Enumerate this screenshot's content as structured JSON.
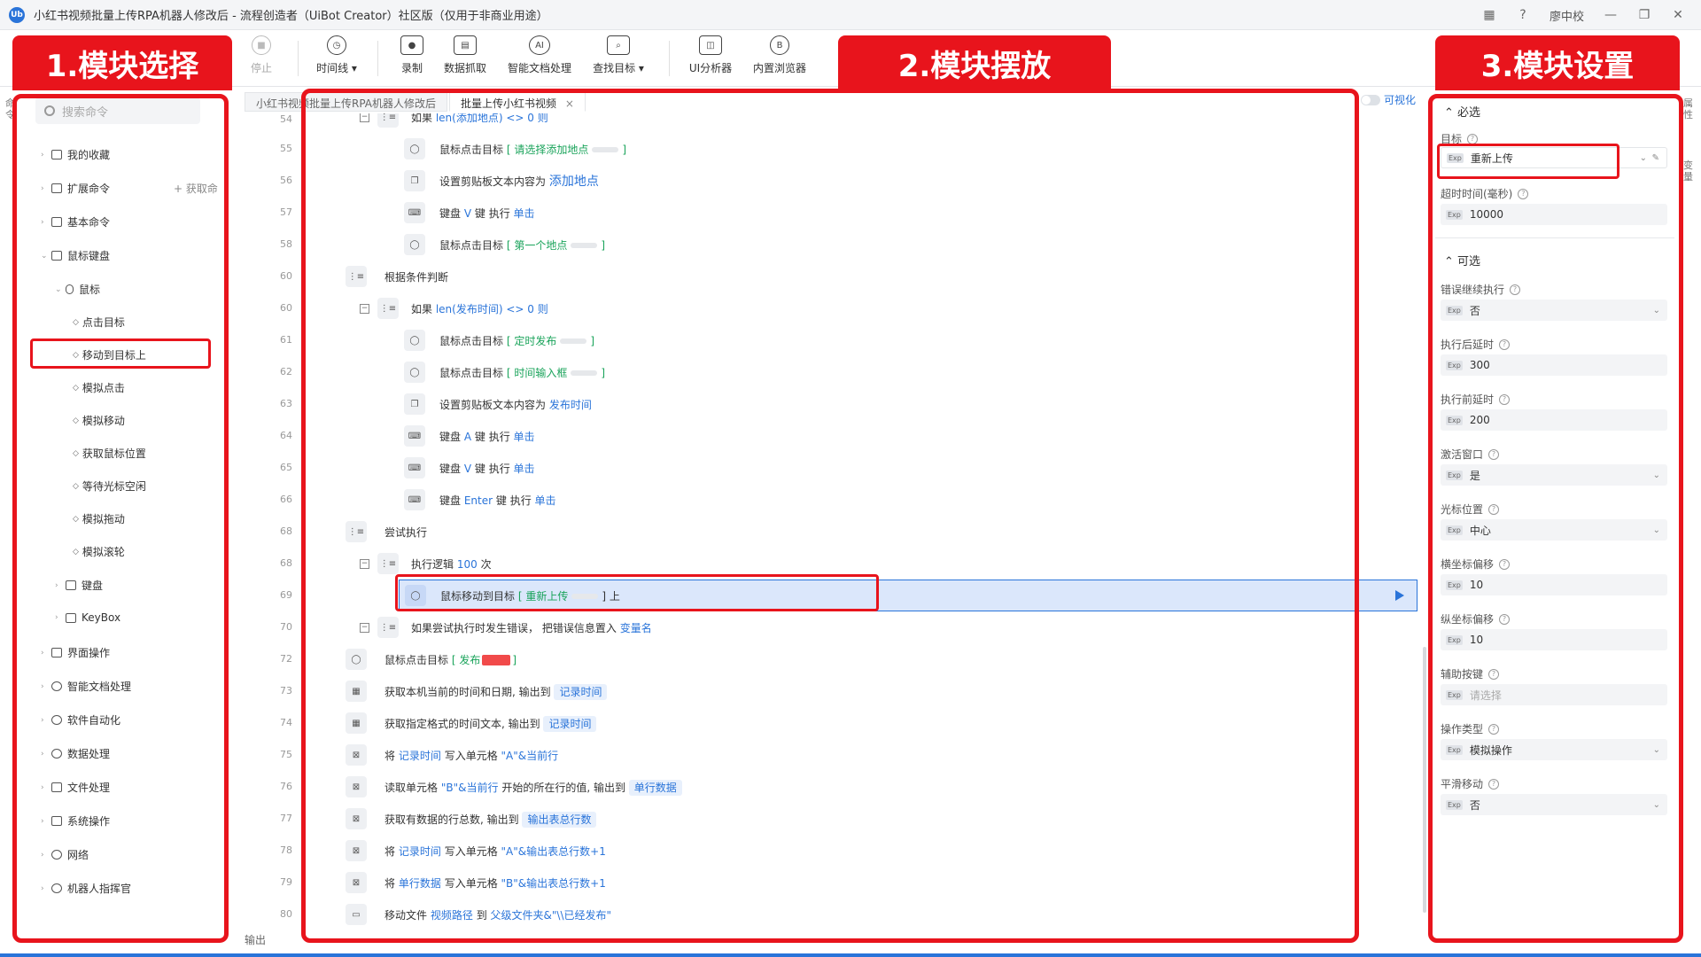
{
  "titlebar": {
    "logo": "Ub",
    "title": "小红书视频批量上传RPA机器人修改后 - 流程创造者（UiBot Creator）社区版（仅用于非商业用途）",
    "user": "廖中校",
    "help": "?"
  },
  "toolbar": {
    "stop": "停止",
    "timeline": "时间线 ▾",
    "record": "录制",
    "data_scrape": "数据抓取",
    "smart_doc": "智能文档处理",
    "find_target": "查找目标 ▾",
    "ui_analyzer": "UI分析器",
    "builtin_browser": "内置浏览器"
  },
  "annotations": {
    "label1": "1.模块选择",
    "label2": "2.模块摆放",
    "label3": "3.模块设置"
  },
  "left": {
    "search_placeholder": "搜索命令",
    "extra_action": "+ 获取命",
    "items": [
      {
        "label": "我的收藏",
        "arrow": "›"
      },
      {
        "label": "扩展命令",
        "arrow": "›"
      },
      {
        "label": "基本命令",
        "arrow": "›"
      },
      {
        "label": "鼠标键盘",
        "arrow": "⌄"
      },
      {
        "label": "鼠标",
        "arrow": "⌄"
      },
      {
        "label": "点击目标"
      },
      {
        "label": "移动到目标上"
      },
      {
        "label": "模拟点击"
      },
      {
        "label": "模拟移动"
      },
      {
        "label": "获取鼠标位置"
      },
      {
        "label": "等待光标空闲"
      },
      {
        "label": "模拟拖动"
      },
      {
        "label": "模拟滚轮"
      },
      {
        "label": "键盘",
        "arrow": "›"
      },
      {
        "label": "KeyBox",
        "arrow": "›"
      },
      {
        "label": "界面操作",
        "arrow": "›"
      },
      {
        "label": "智能文档处理",
        "arrow": "›"
      },
      {
        "label": "软件自动化",
        "arrow": "›"
      },
      {
        "label": "数据处理",
        "arrow": "›"
      },
      {
        "label": "文件处理",
        "arrow": "›"
      },
      {
        "label": "系统操作",
        "arrow": "›"
      },
      {
        "label": "网络",
        "arrow": "›"
      },
      {
        "label": "机器人指挥官",
        "arrow": "›"
      }
    ]
  },
  "center": {
    "tab1": "小红书视频批量上传RPA机器人修改后",
    "tab2": "批量上传小红书视频",
    "tab_close": "×",
    "visual_toggle": "可视化",
    "output": "输出",
    "lines": [
      "54",
      "55",
      "56",
      "57",
      "58",
      "60",
      "60",
      "61",
      "62",
      "63",
      "64",
      "65",
      "66",
      "68",
      "68",
      "69",
      "70",
      "72",
      "73",
      "74",
      "75",
      "76",
      "77",
      "78",
      "79",
      "80"
    ],
    "rows": {
      "r54": {
        "a": "如果",
        "b": "len(添加地点)",
        "c": "<> 0 则"
      },
      "r55": {
        "a": "鼠标点击目标",
        "b": "[ 请选择添加地点",
        "c": "]"
      },
      "r56": {
        "a": "设置剪贴板文本内容为",
        "b": "添加地点"
      },
      "r57": {
        "a": "键盘",
        "b": "V",
        "c": "键 执行",
        "d": "单击"
      },
      "r58": {
        "a": "鼠标点击目标",
        "b": "[ 第一个地点",
        "c": "]"
      },
      "r60a": {
        "a": "根据条件判断"
      },
      "r60b": {
        "a": "如果",
        "b": "len(发布时间)",
        "c": "<> 0 则"
      },
      "r61": {
        "a": "鼠标点击目标",
        "b": "[ 定时发布",
        "c": "]"
      },
      "r62": {
        "a": "鼠标点击目标",
        "b": "[ 时间输入框",
        "c": "]"
      },
      "r63": {
        "a": "设置剪贴板文本内容为",
        "b": "发布时间"
      },
      "r64": {
        "a": "键盘",
        "b": "A",
        "c": "键 执行",
        "d": "单击"
      },
      "r65": {
        "a": "键盘",
        "b": "V",
        "c": "键 执行",
        "d": "单击"
      },
      "r66": {
        "a": "键盘",
        "b": "Enter",
        "c": "键 执行",
        "d": "单击"
      },
      "r68a": {
        "a": "尝试执行"
      },
      "r68b": {
        "a": "执行逻辑",
        "b": "100",
        "c": "次"
      },
      "r69": {
        "a": "鼠标移动到目标",
        "b": "[ 重新上传",
        "c": "] 上"
      },
      "r70": {
        "a": "如果尝试执行时发生错误，",
        "b": "把错误信息置入",
        "c": "变量名"
      },
      "r72": {
        "a": "鼠标点击目标",
        "b": "[ 发布",
        "c": "]"
      },
      "r73": {
        "a": "获取本机当前的时间和日期, 输出到",
        "b": "记录时间"
      },
      "r74": {
        "a": "获取指定格式的时间文本, 输出到",
        "b": "记录时间"
      },
      "r75": {
        "a": "将",
        "b": "记录时间",
        "c": "写入单元格",
        "d": "\"A\"&当前行"
      },
      "r76": {
        "a": "读取单元格",
        "b": "\"B\"&当前行",
        "c": "开始的所在行的值, 输出到",
        "d": "单行数据"
      },
      "r77": {
        "a": "获取有数据的行总数, 输出到",
        "b": "输出表总行数"
      },
      "r78": {
        "a": "将",
        "b": "记录时间",
        "c": "写入单元格",
        "d": "\"A\"&输出表总行数+1"
      },
      "r79": {
        "a": "将",
        "b": "单行数据",
        "c": "写入单元格",
        "d": "\"B\"&输出表总行数+1"
      },
      "r80": {
        "a": "移动文件",
        "b": "视频路径",
        "c": "到",
        "d": "父级文件夹&\"\\\\已经发布\""
      }
    }
  },
  "right": {
    "required_title": "⌃ 必选",
    "optional_title": "⌃ 可选",
    "exp": "Exp",
    "fields": {
      "target": {
        "label": "目标",
        "value": "重新上传"
      },
      "timeout": {
        "label": "超时时间(毫秒)",
        "value": "10000"
      },
      "continue_on_error": {
        "label": "错误继续执行",
        "value": "否"
      },
      "delay_after": {
        "label": "执行后延时",
        "value": "300"
      },
      "delay_before": {
        "label": "执行前延时",
        "value": "200"
      },
      "activate_window": {
        "label": "激活窗口",
        "value": "是"
      },
      "cursor_position": {
        "label": "光标位置",
        "value": "中心"
      },
      "offset_x": {
        "label": "横坐标偏移",
        "value": "10"
      },
      "offset_y": {
        "label": "纵坐标偏移",
        "value": "10"
      },
      "aux_key": {
        "label": "辅助按键",
        "placeholder": "请选择"
      },
      "op_type": {
        "label": "操作类型",
        "value": "模拟操作"
      },
      "smooth_move": {
        "label": "平滑移动",
        "value": "否"
      }
    }
  },
  "edges": {
    "left": "命令",
    "right1": "属性",
    "right2": "变量"
  },
  "colors": {
    "accent": "#2a74d9",
    "annotation_red": "#e8141c",
    "highlight_row": "#dbe7fb",
    "green_target": "#19a35a"
  }
}
